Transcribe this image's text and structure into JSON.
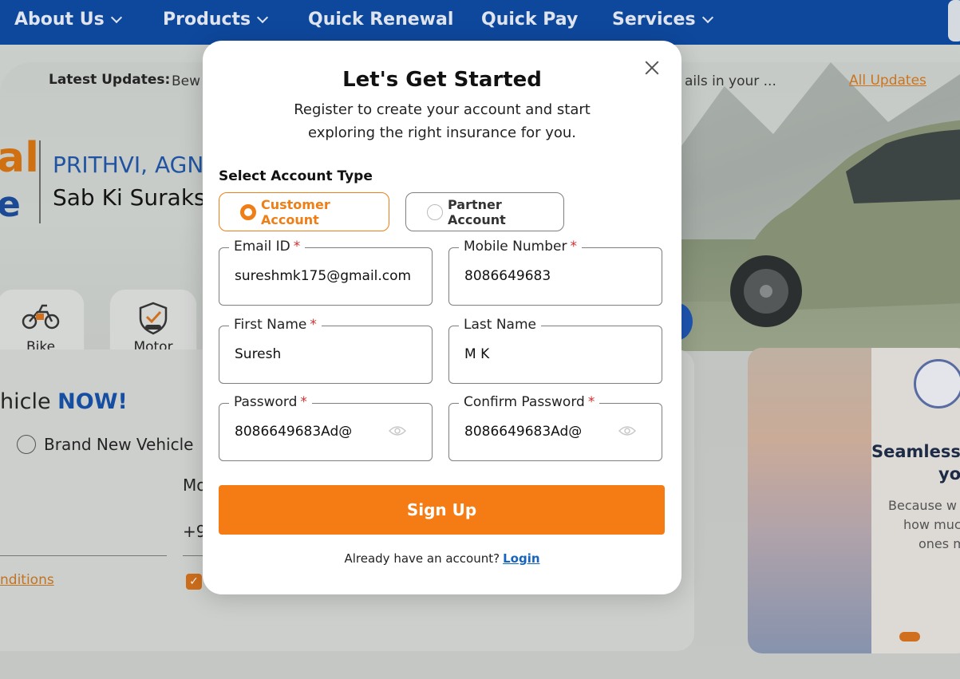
{
  "nav": {
    "items": [
      {
        "label": "About Us",
        "has_dropdown": true
      },
      {
        "label": "Products",
        "has_dropdown": true
      },
      {
        "label": "Quick Renewal",
        "has_dropdown": false
      },
      {
        "label": "Quick Pay",
        "has_dropdown": false
      },
      {
        "label": "Services",
        "has_dropdown": true
      }
    ]
  },
  "background": {
    "latest_updates_label": "Latest Updates:",
    "latest_updates_text": "Bew",
    "latest_updates_tail": "ails in your ...",
    "all_updates_link": "All Updates",
    "brand_line1": "al",
    "brand_line2": "e",
    "tagline1": "PRITHVI, AGN",
    "tagline2": "Sab Ki Suraks",
    "categories": [
      {
        "label": "Bike",
        "icon": "bike-icon"
      },
      {
        "label": "Motor",
        "icon": "motor-shield-icon"
      }
    ],
    "vehicle_prefix": "hicle ",
    "vehicle_highlight": "NOW!",
    "brand_new_vehicle": "Brand New Vehicle",
    "mo_label": "Mo",
    "phone_prefix": "+9",
    "conditions_link": "nditions",
    "checkbox_mark": "✓",
    "promo": {
      "headline1": "Seamlessl",
      "headline2": "yo",
      "body1": "Because w",
      "body2": "how muc",
      "body3": "ones m"
    }
  },
  "modal": {
    "title": "Let's Get Started",
    "subtitle": "Register to create your account and start exploring the right insurance for you.",
    "account_type_label": "Select Account Type",
    "account_types": [
      {
        "label": "Customer Account",
        "selected": true
      },
      {
        "label": "Partner Account",
        "selected": false
      }
    ],
    "fields": {
      "email": {
        "label": "Email ID",
        "required": "*",
        "value": "sureshmk175@gmail.com"
      },
      "mobile": {
        "label": "Mobile Number",
        "required": "*",
        "value": "8086649683"
      },
      "first_name": {
        "label": "First Name",
        "required": "*",
        "value": "Suresh"
      },
      "last_name": {
        "label": "Last Name",
        "required": "",
        "value": "M K"
      },
      "password": {
        "label": "Password",
        "required": "*",
        "value": "8086649683Ad@"
      },
      "confirm_password": {
        "label": "Confirm Password",
        "required": "*",
        "value": "8086649683Ad@"
      }
    },
    "signup_label": "Sign Up",
    "already_text": "Already have an account?",
    "login_label": "Login"
  },
  "colors": {
    "nav_bg": "#0b49a3",
    "accent_orange": "#f57c14",
    "link_blue": "#1565c0",
    "required_red": "#d32f2f"
  }
}
